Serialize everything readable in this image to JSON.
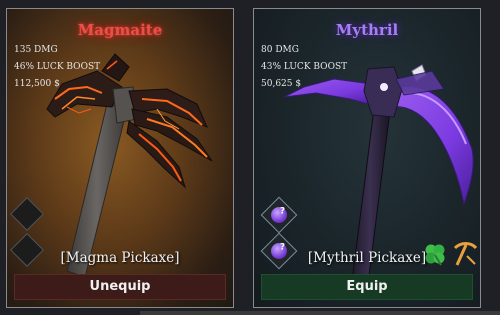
{
  "cards": [
    {
      "title": "Magmaite",
      "stats": [
        "135 DMG",
        "46% LUCK BOOST",
        "112,500 $"
      ],
      "item_name": "[Magma Pickaxe]",
      "action_label": "Unequip",
      "title_color": "#e8504a",
      "accent_color": "#3d1b18"
    },
    {
      "title": "Mythril",
      "stats": [
        "80 DMG",
        "43% LUCK BOOST",
        "50,625 $"
      ],
      "item_name": "[Mythril Pickaxe]",
      "action_label": "Equip",
      "title_color": "#a77ef5",
      "accent_color": "#163a24",
      "gem_marks": [
        "?",
        "?"
      ],
      "badge_icons": [
        "four-leaf-clover-icon",
        "pickaxe-icon"
      ]
    }
  ]
}
